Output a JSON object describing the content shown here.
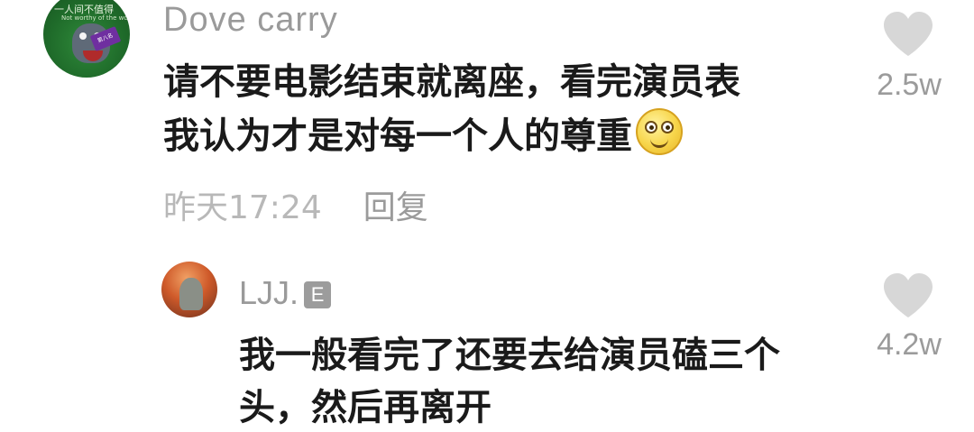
{
  "main_comment": {
    "username": "Dove carry",
    "avatar_caption_line1": "一人间不值得",
    "avatar_caption_line2": "Not worthy of the world",
    "avatar_card_text": "第八名",
    "text_line1": "请不要电影结束就离座，看完演员表",
    "text_line2": "我认为才是对每一个人的尊重",
    "emoji": "smiling-face-emoji",
    "timestamp": "昨天17:24",
    "reply_label": "回复",
    "likes": "2.5w"
  },
  "reply_comment": {
    "username": "LJJ.",
    "badge": "E",
    "text_line1": "我一般看完了还要去给演员磕三个",
    "text_line2": "头，然后再离开",
    "likes": "4.2w"
  },
  "colors": {
    "text_primary": "#1a1a1a",
    "text_secondary": "#9a9a9a",
    "heart": "#d7d7d7"
  }
}
